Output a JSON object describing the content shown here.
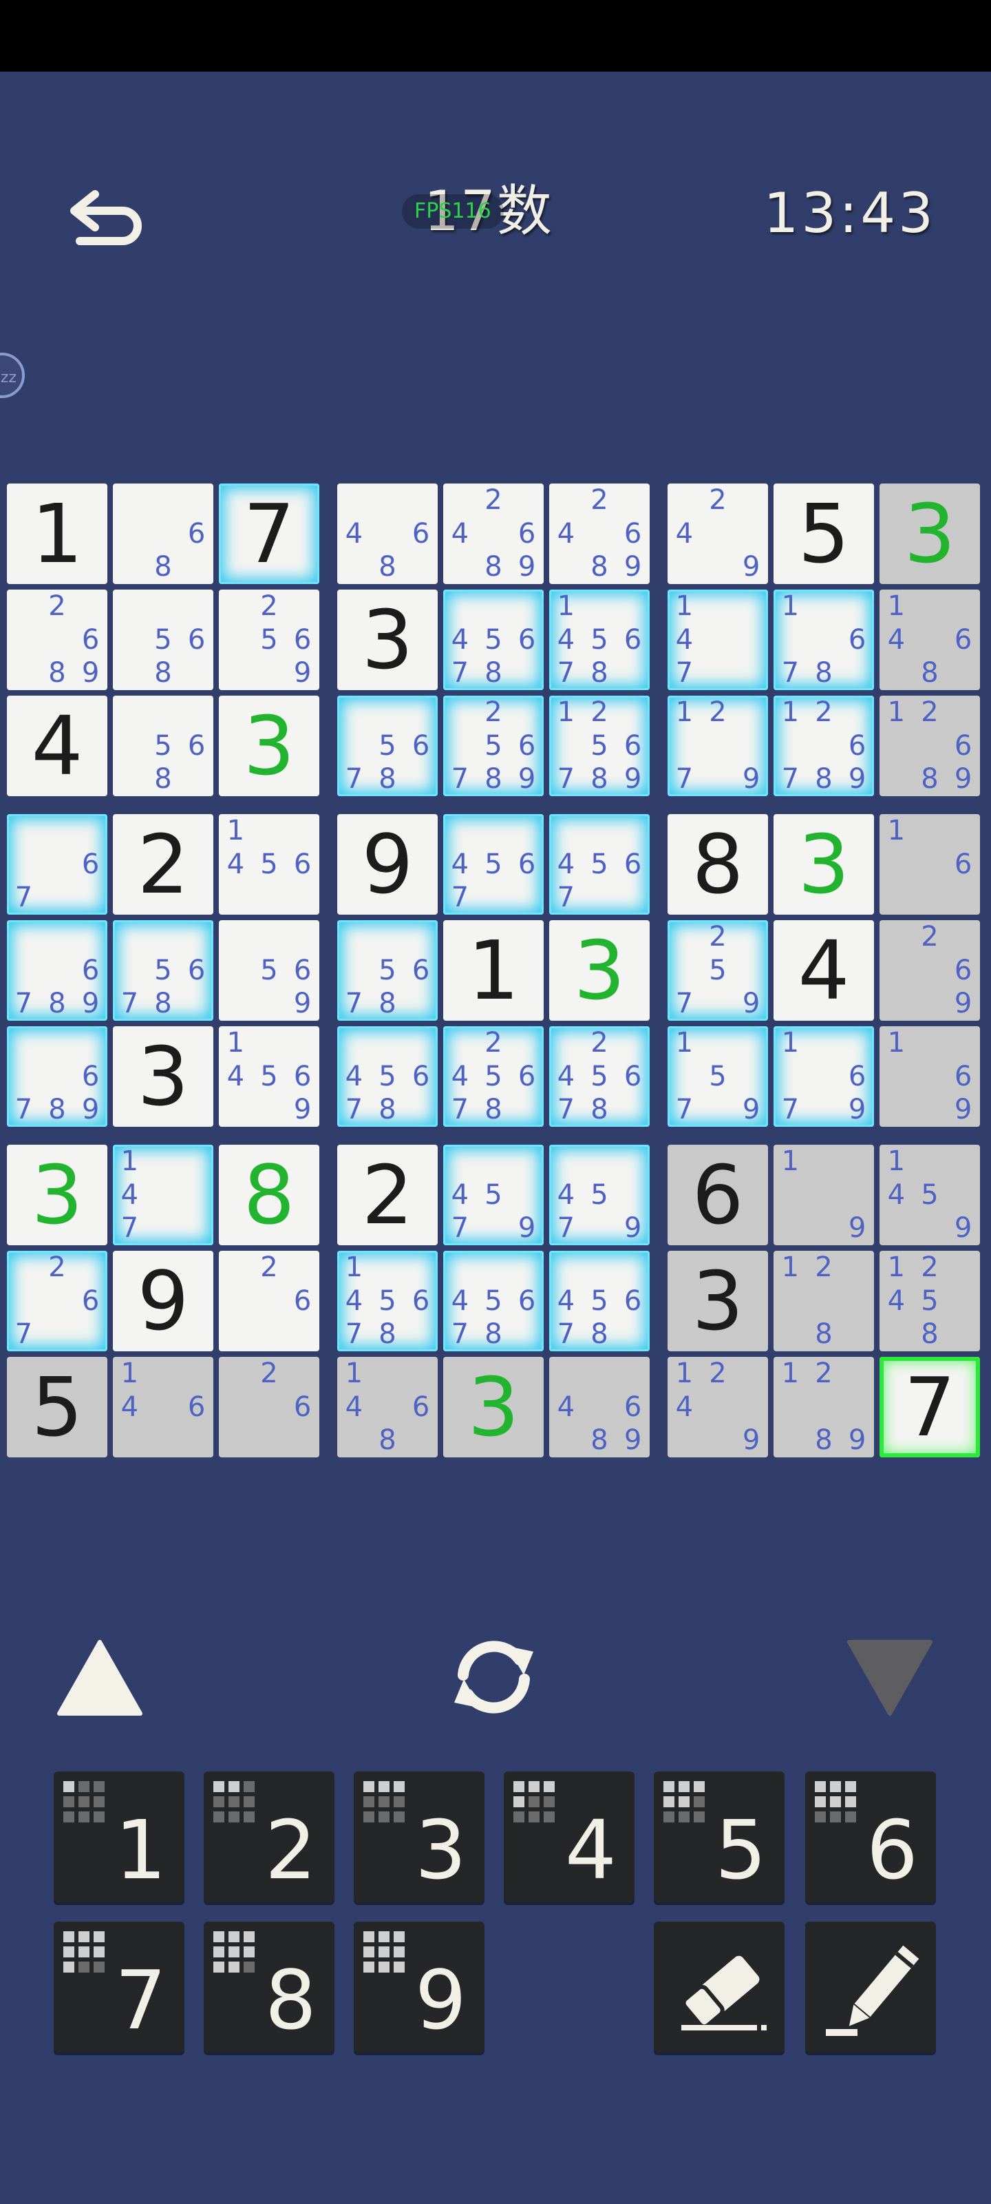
{
  "header": {
    "title": "17数",
    "fps": "FPS116",
    "timer": "13:43",
    "sleep_badge": "zz"
  },
  "colors": {
    "background": "#313e6b",
    "given_digit": "#1c1c1c",
    "user_digit": "#23b42f",
    "note_digit": "#4e62c4",
    "cell": "#f4f4f2",
    "cell_gray": "#c9c9c9",
    "highlight_glow": "#35c9f0",
    "selected_glow": "#2ee83b"
  },
  "board": {
    "rows": [
      [
        {
          "v": "1"
        },
        {
          "n": [
            6,
            8
          ]
        },
        {
          "v": "7",
          "h": 1
        },
        {
          "n": [
            4,
            6,
            8
          ]
        },
        {
          "n": [
            2,
            4,
            6,
            8,
            9
          ]
        },
        {
          "n": [
            2,
            4,
            6,
            8,
            9
          ]
        },
        {
          "n": [
            2,
            4,
            9
          ]
        },
        {
          "v": "5"
        },
        {
          "v": "3",
          "g": 1,
          "gr": 1
        }
      ],
      [
        {
          "n": [
            2,
            6,
            8,
            9
          ]
        },
        {
          "n": [
            5,
            6,
            8
          ]
        },
        {
          "n": [
            2,
            5,
            6,
            9
          ]
        },
        {
          "v": "3"
        },
        {
          "n": [
            4,
            5,
            6,
            7,
            8
          ],
          "h": 1
        },
        {
          "n": [
            1,
            4,
            5,
            6,
            7,
            8
          ],
          "h": 1
        },
        {
          "n": [
            1,
            4,
            7
          ],
          "h": 1
        },
        {
          "n": [
            1,
            6,
            7,
            8
          ],
          "h": 1
        },
        {
          "n": [
            1,
            4,
            6,
            8
          ],
          "gr": 1
        }
      ],
      [
        {
          "v": "4"
        },
        {
          "n": [
            5,
            6,
            8
          ]
        },
        {
          "v": "3",
          "g": 1
        },
        {
          "n": [
            5,
            6,
            7,
            8
          ],
          "h": 1
        },
        {
          "n": [
            2,
            5,
            6,
            7,
            8,
            9
          ],
          "h": 1
        },
        {
          "n": [
            1,
            2,
            5,
            6,
            7,
            8,
            9
          ],
          "h": 1
        },
        {
          "n": [
            1,
            2,
            7,
            9
          ],
          "h": 1
        },
        {
          "n": [
            1,
            2,
            6,
            7,
            8,
            9
          ],
          "h": 1
        },
        {
          "n": [
            1,
            2,
            6,
            8,
            9
          ],
          "gr": 1
        }
      ],
      [
        {
          "n": [
            6,
            7
          ],
          "h": 1
        },
        {
          "v": "2"
        },
        {
          "n": [
            1,
            4,
            5,
            6
          ]
        },
        {
          "v": "9"
        },
        {
          "n": [
            4,
            5,
            6,
            7
          ],
          "h": 1
        },
        {
          "n": [
            4,
            5,
            6,
            7
          ],
          "h": 1
        },
        {
          "v": "8"
        },
        {
          "v": "3",
          "g": 1
        },
        {
          "n": [
            1,
            6
          ],
          "gr": 1
        }
      ],
      [
        {
          "n": [
            6,
            7,
            8,
            9
          ],
          "h": 1
        },
        {
          "n": [
            5,
            6,
            7,
            8
          ],
          "h": 1
        },
        {
          "n": [
            5,
            6,
            9
          ]
        },
        {
          "n": [
            5,
            6,
            7,
            8
          ],
          "h": 1
        },
        {
          "v": "1"
        },
        {
          "v": "3",
          "g": 1
        },
        {
          "n": [
            2,
            5,
            7,
            9
          ],
          "h": 1
        },
        {
          "v": "4"
        },
        {
          "n": [
            2,
            6,
            9
          ],
          "gr": 1
        }
      ],
      [
        {
          "n": [
            6,
            7,
            8,
            9
          ],
          "h": 1
        },
        {
          "v": "3"
        },
        {
          "n": [
            1,
            4,
            5,
            6,
            9
          ]
        },
        {
          "n": [
            4,
            5,
            6,
            7,
            8
          ],
          "h": 1
        },
        {
          "n": [
            2,
            4,
            5,
            6,
            7,
            8
          ],
          "h": 1
        },
        {
          "n": [
            2,
            4,
            5,
            6,
            7,
            8
          ],
          "h": 1
        },
        {
          "n": [
            1,
            5,
            7,
            9
          ],
          "h": 1
        },
        {
          "n": [
            1,
            6,
            7,
            9
          ],
          "h": 1
        },
        {
          "n": [
            1,
            6,
            9
          ],
          "gr": 1
        }
      ],
      [
        {
          "v": "3",
          "g": 1
        },
        {
          "n": [
            1,
            4,
            7
          ],
          "h": 1
        },
        {
          "v": "8",
          "g": 1
        },
        {
          "v": "2"
        },
        {
          "n": [
            4,
            5,
            7,
            9
          ],
          "h": 1
        },
        {
          "n": [
            4,
            5,
            7,
            9
          ],
          "h": 1
        },
        {
          "v": "6",
          "gr": 1
        },
        {
          "n": [
            1,
            9
          ],
          "gr": 1
        },
        {
          "n": [
            1,
            4,
            5,
            9
          ],
          "gr": 1
        }
      ],
      [
        {
          "n": [
            2,
            6,
            7
          ],
          "h": 1
        },
        {
          "v": "9"
        },
        {
          "n": [
            2,
            6
          ]
        },
        {
          "n": [
            1,
            4,
            5,
            6,
            7,
            8
          ],
          "h": 1
        },
        {
          "n": [
            4,
            5,
            6,
            7,
            8
          ],
          "h": 1
        },
        {
          "n": [
            4,
            5,
            6,
            7,
            8
          ],
          "h": 1
        },
        {
          "v": "3",
          "gr": 1
        },
        {
          "n": [
            1,
            2,
            8
          ],
          "gr": 1
        },
        {
          "n": [
            1,
            2,
            4,
            5,
            8
          ],
          "gr": 1
        }
      ],
      [
        {
          "v": "5",
          "gr": 1
        },
        {
          "n": [
            1,
            4,
            6
          ],
          "gr": 1
        },
        {
          "n": [
            2,
            6
          ],
          "gr": 1
        },
        {
          "n": [
            1,
            4,
            6,
            8
          ],
          "gr": 1
        },
        {
          "v": "3",
          "g": 1,
          "gr": 1
        },
        {
          "n": [
            4,
            6,
            8,
            9
          ],
          "gr": 1
        },
        {
          "n": [
            1,
            2,
            4,
            9
          ],
          "gr": 1
        },
        {
          "n": [
            1,
            2,
            8,
            9
          ],
          "gr": 1
        },
        {
          "v": "7",
          "sel": 1
        }
      ]
    ]
  },
  "controls": {
    "up_icon": "triangle-up-icon",
    "refresh_icon": "refresh-icon",
    "down_icon": "triangle-down-icon"
  },
  "keypad": {
    "numbers": [
      "1",
      "2",
      "3",
      "4",
      "5",
      "6",
      "7",
      "8",
      "9"
    ],
    "eraser_icon": "eraser-icon",
    "pencil_icon": "pencil-icon"
  }
}
